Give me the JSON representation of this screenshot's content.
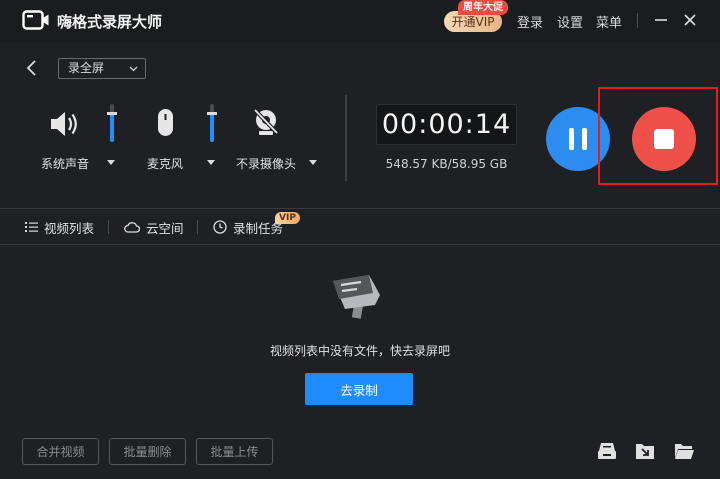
{
  "app": {
    "title": "嗨格式录屏大师"
  },
  "header": {
    "vip_label": "开通VIP",
    "promo_label": "周年大促",
    "menu": [
      "登录",
      "设置",
      "菜单"
    ]
  },
  "toolbar": {
    "mode": "录全屏"
  },
  "devices": [
    {
      "label": "系统声音",
      "level": 0.75
    },
    {
      "label": "麦克风",
      "level": 0.75
    },
    {
      "label": "不录摄像头"
    }
  ],
  "recording": {
    "time": "00:00:14",
    "size": "548.57 KB/58.95 GB"
  },
  "tabs": [
    {
      "label": "视频列表"
    },
    {
      "label": "云空间"
    },
    {
      "label": "录制任务",
      "badge": "VIP"
    }
  ],
  "empty_state": {
    "message": "视频列表中没有文件，快去录屏吧",
    "action": "去录制"
  },
  "footer": {
    "buttons": [
      "合并视频",
      "批量删除",
      "批量上传"
    ],
    "icons": [
      "import-icon",
      "export-icon",
      "folder-icon"
    ]
  },
  "colors": {
    "accent": "#1e8cff",
    "stop": "#f0504a",
    "highlight": "#e02020"
  }
}
